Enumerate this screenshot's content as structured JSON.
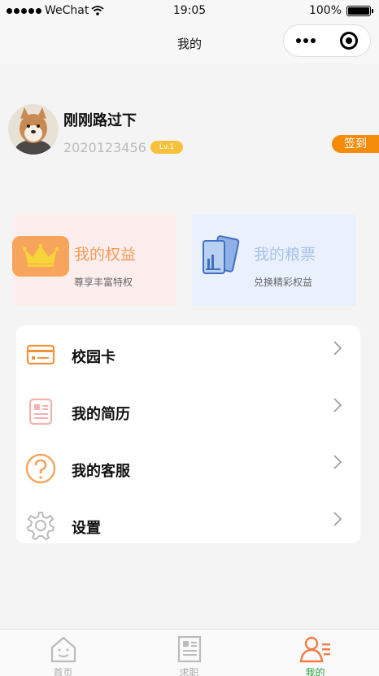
{
  "status_bar": {
    "carrier": "WeChat",
    "time": "19:05",
    "battery": "100%"
  },
  "nav": {
    "title": "我的"
  },
  "profile": {
    "name": "刚刚路过下",
    "id": "2020123456",
    "level": "Lv.1",
    "signin_label": "签到"
  },
  "cards": [
    {
      "title": "我的权益",
      "subtitle": "尊享丰富特权",
      "icon": "crown-icon"
    },
    {
      "title": "我的粮票",
      "subtitle": "兑换精彩权益",
      "icon": "ticket-icon"
    }
  ],
  "menu": {
    "items": [
      {
        "label": "校园卡",
        "icon": "campus-card-icon"
      },
      {
        "label": "我的简历",
        "icon": "resume-icon"
      },
      {
        "label": "我的客服",
        "icon": "help-icon"
      },
      {
        "label": "设置",
        "icon": "gear-icon"
      }
    ]
  },
  "tabs": [
    {
      "label": "首页",
      "icon": "home-icon",
      "active": false
    },
    {
      "label": "求职",
      "icon": "job-doc-icon",
      "active": false
    },
    {
      "label": "我的",
      "icon": "profile-icon",
      "active": true
    }
  ],
  "colors": {
    "accent": "#f58b0a",
    "active_tab": "#23a03a",
    "rights_bg": "#fdeeee",
    "tickets_bg": "#eaf1fd"
  }
}
